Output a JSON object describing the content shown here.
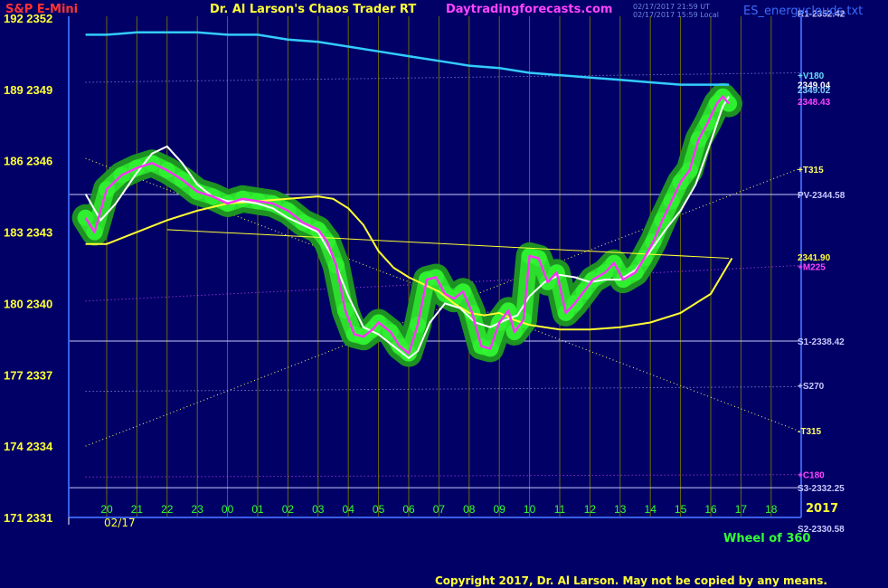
{
  "header": {
    "symbol": "S&P E-Mini",
    "title": "Dr. Al Larson's Chaos Trader RT",
    "site": "Daytradingforecasts.com",
    "stamp1": "02/17/2017 21:59 UT",
    "stamp2": "02/17/2017 15:59 Local",
    "instrument": "ES_energyclouds.txt"
  },
  "footer": {
    "copyright": "Copyright 2017, Dr. Al Larson. May not be copied by any means.",
    "wheel": "Wheel of 360",
    "year": "2017",
    "date": "02/17"
  },
  "colors": {
    "background": "#000066",
    "grid": "#6b6b00",
    "axis": "#3a5ee8",
    "price": "#ff33ff",
    "cloud_outer": "#1f9a1f",
    "cloud_inner": "#2fe62f",
    "slow_ma": "#ffff33",
    "fast_ma": "#ffffff",
    "v180": "#33ccff"
  },
  "chart_data": {
    "type": "line",
    "title": "S&P E-Mini",
    "xlabel": "",
    "ylabel": "",
    "ylim": [
      2331,
      2352
    ],
    "xlim": [
      19.3,
      18.6
    ],
    "x_ticks": [
      "20",
      "21",
      "22",
      "23",
      "00",
      "01",
      "02",
      "03",
      "04",
      "05",
      "06",
      "07",
      "08",
      "09",
      "10",
      "11",
      "12",
      "13",
      "14",
      "15",
      "16",
      "17",
      "18"
    ],
    "y_ticks": [
      {
        "left": "171",
        "value": "2331"
      },
      {
        "left": "174",
        "value": "2334"
      },
      {
        "left": "177",
        "value": "2337"
      },
      {
        "left": "180",
        "value": "2340"
      },
      {
        "left": "183",
        "value": "2343"
      },
      {
        "left": "186",
        "value": "2346"
      },
      {
        "left": "189",
        "value": "2349"
      },
      {
        "left": "192",
        "value": "2352"
      }
    ],
    "series": [
      {
        "name": "price",
        "values": [
          [
            19.3,
            2343.6
          ],
          [
            19.6,
            2343.0
          ],
          [
            20.0,
            2344.8
          ],
          [
            20.5,
            2345.4
          ],
          [
            21.0,
            2345.7
          ],
          [
            21.5,
            2345.9
          ],
          [
            22.0,
            2345.6
          ],
          [
            22.5,
            2345.2
          ],
          [
            23.0,
            2344.7
          ],
          [
            23.5,
            2344.5
          ],
          [
            0.0,
            2344.2
          ],
          [
            0.5,
            2344.4
          ],
          [
            1.0,
            2344.3
          ],
          [
            1.5,
            2344.2
          ],
          [
            2.0,
            2343.9
          ],
          [
            2.5,
            2343.4
          ],
          [
            3.0,
            2343.1
          ],
          [
            3.3,
            2342.6
          ],
          [
            3.6,
            2341.6
          ],
          [
            3.9,
            2339.7
          ],
          [
            4.2,
            2338.7
          ],
          [
            4.5,
            2338.6
          ],
          [
            4.8,
            2338.9
          ],
          [
            5.0,
            2339.2
          ],
          [
            5.4,
            2338.8
          ],
          [
            5.7,
            2338.2
          ],
          [
            6.0,
            2337.9
          ],
          [
            6.3,
            2339.1
          ],
          [
            6.6,
            2341.0
          ],
          [
            6.9,
            2341.1
          ],
          [
            7.2,
            2340.4
          ],
          [
            7.5,
            2340.2
          ],
          [
            7.8,
            2340.5
          ],
          [
            8.1,
            2339.6
          ],
          [
            8.4,
            2338.2
          ],
          [
            8.7,
            2338.1
          ],
          [
            9.0,
            2339.2
          ],
          [
            9.3,
            2339.7
          ],
          [
            9.5,
            2338.8
          ],
          [
            9.8,
            2339.3
          ],
          [
            10.0,
            2342.0
          ],
          [
            10.3,
            2341.9
          ],
          [
            10.6,
            2340.9
          ],
          [
            10.9,
            2341.3
          ],
          [
            11.2,
            2339.6
          ],
          [
            11.5,
            2340.0
          ],
          [
            11.8,
            2340.5
          ],
          [
            12.1,
            2341.0
          ],
          [
            12.5,
            2341.3
          ],
          [
            12.8,
            2341.7
          ],
          [
            13.1,
            2341.0
          ],
          [
            13.5,
            2341.3
          ],
          [
            13.8,
            2341.9
          ],
          [
            14.1,
            2342.6
          ],
          [
            14.4,
            2343.5
          ],
          [
            14.7,
            2344.3
          ],
          [
            15.0,
            2345.1
          ],
          [
            15.3,
            2345.6
          ],
          [
            15.6,
            2346.9
          ],
          [
            15.9,
            2347.6
          ],
          [
            16.2,
            2348.4
          ],
          [
            16.4,
            2348.7
          ],
          [
            16.6,
            2348.4
          ]
        ]
      },
      {
        "name": "fast_ma",
        "values": [
          [
            19.3,
            2344.6
          ],
          [
            19.8,
            2343.5
          ],
          [
            20.3,
            2344.2
          ],
          [
            21.0,
            2345.5
          ],
          [
            21.5,
            2346.3
          ],
          [
            22.0,
            2346.6
          ],
          [
            22.5,
            2345.9
          ],
          [
            23.0,
            2345.0
          ],
          [
            23.5,
            2344.5
          ],
          [
            0.0,
            2344.3
          ],
          [
            0.5,
            2344.3
          ],
          [
            1.0,
            2344.2
          ],
          [
            1.5,
            2344.0
          ],
          [
            2.0,
            2343.6
          ],
          [
            2.5,
            2343.3
          ],
          [
            3.0,
            2343.0
          ],
          [
            3.5,
            2341.9
          ],
          [
            4.0,
            2340.3
          ],
          [
            4.5,
            2339.0
          ],
          [
            5.0,
            2338.7
          ],
          [
            5.5,
            2338.2
          ],
          [
            6.0,
            2337.7
          ],
          [
            6.3,
            2338.0
          ],
          [
            6.7,
            2339.2
          ],
          [
            7.2,
            2340.0
          ],
          [
            7.7,
            2339.8
          ],
          [
            8.2,
            2339.2
          ],
          [
            8.7,
            2339.0
          ],
          [
            9.2,
            2339.3
          ],
          [
            9.6,
            2339.5
          ],
          [
            10.0,
            2340.3
          ],
          [
            10.5,
            2340.9
          ],
          [
            11.0,
            2341.2
          ],
          [
            11.5,
            2341.1
          ],
          [
            12.0,
            2340.9
          ],
          [
            12.5,
            2341.0
          ],
          [
            13.0,
            2341.0
          ],
          [
            13.5,
            2341.4
          ],
          [
            14.0,
            2342.2
          ],
          [
            14.5,
            2343.1
          ],
          [
            15.0,
            2343.9
          ],
          [
            15.5,
            2345.0
          ],
          [
            16.0,
            2346.8
          ],
          [
            16.4,
            2348.3
          ],
          [
            16.6,
            2348.7
          ]
        ]
      },
      {
        "name": "slow_ma",
        "values": [
          [
            19.3,
            2342.5
          ],
          [
            20.0,
            2342.5
          ],
          [
            21.0,
            2343.0
          ],
          [
            22.0,
            2343.5
          ],
          [
            23.0,
            2343.9
          ],
          [
            0.0,
            2344.2
          ],
          [
            1.0,
            2344.3
          ],
          [
            2.0,
            2344.4
          ],
          [
            3.0,
            2344.5
          ],
          [
            3.5,
            2344.4
          ],
          [
            4.0,
            2344.0
          ],
          [
            4.5,
            2343.3
          ],
          [
            5.0,
            2342.2
          ],
          [
            5.5,
            2341.5
          ],
          [
            6.0,
            2341.1
          ],
          [
            6.5,
            2340.8
          ],
          [
            7.0,
            2340.5
          ],
          [
            7.5,
            2340.0
          ],
          [
            8.0,
            2339.6
          ],
          [
            8.5,
            2339.5
          ],
          [
            9.0,
            2339.6
          ],
          [
            9.5,
            2339.3
          ],
          [
            10.0,
            2339.1
          ],
          [
            10.5,
            2339.0
          ],
          [
            11.0,
            2338.9
          ],
          [
            11.5,
            2338.9
          ],
          [
            12.0,
            2338.9
          ],
          [
            13.0,
            2339.0
          ],
          [
            14.0,
            2339.2
          ],
          [
            15.0,
            2339.6
          ],
          [
            16.0,
            2340.4
          ],
          [
            16.7,
            2341.9
          ]
        ]
      },
      {
        "name": "V180",
        "values": [
          [
            19.3,
            2351.3
          ],
          [
            20.0,
            2351.3
          ],
          [
            21.0,
            2351.4
          ],
          [
            22.0,
            2351.4
          ],
          [
            23.0,
            2351.4
          ],
          [
            0.0,
            2351.3
          ],
          [
            1.0,
            2351.3
          ],
          [
            2.0,
            2351.1
          ],
          [
            3.0,
            2351.0
          ],
          [
            4.0,
            2350.8
          ],
          [
            5.0,
            2350.6
          ],
          [
            6.0,
            2350.4
          ],
          [
            7.0,
            2350.2
          ],
          [
            8.0,
            2350.0
          ],
          [
            9.0,
            2349.9
          ],
          [
            10.0,
            2349.7
          ],
          [
            11.0,
            2349.6
          ],
          [
            12.0,
            2349.5
          ],
          [
            13.0,
            2349.4
          ],
          [
            14.0,
            2349.3
          ],
          [
            15.0,
            2349.2
          ],
          [
            16.0,
            2349.2
          ],
          [
            16.6,
            2349.2
          ]
        ]
      },
      {
        "name": "yellow_trend",
        "values": [
          [
            22.0,
            2343.1
          ],
          [
            16.6,
            2341.9
          ]
        ]
      }
    ],
    "hlines": [
      {
        "label": "PV-2344.58",
        "value": 2344.58
      },
      {
        "label": "S1-2338.42",
        "value": 2338.42
      },
      {
        "label": "S3-2332.25",
        "value": 2332.25
      }
    ],
    "dotted_lines": [
      {
        "label": "+V180",
        "from": [
          19.3,
          2349.3
        ],
        "to": [
          18.6,
          2349.7
        ],
        "color": "#9999ff"
      },
      {
        "label": "+T315",
        "from": [
          19.3,
          2334.0
        ],
        "to": [
          18.6,
          2345.7
        ],
        "color": "#ffff66"
      },
      {
        "label": "-T315",
        "from": [
          19.3,
          2346.1
        ],
        "to": [
          18.6,
          2334.6
        ],
        "color": "#ffff66"
      },
      {
        "label": "+M225",
        "from": [
          19.3,
          2340.1
        ],
        "to": [
          18.6,
          2341.6
        ],
        "color": "#cc44ff"
      },
      {
        "label": "+S270",
        "from": [
          19.3,
          2336.3
        ],
        "to": [
          18.6,
          2336.5
        ],
        "color": "#aaaaff"
      },
      {
        "label": "+C180",
        "from": [
          19.3,
          2332.7
        ],
        "to": [
          18.6,
          2332.8
        ],
        "color": "#cc44ff"
      }
    ],
    "right_labels": [
      {
        "text": "R1-2352.42",
        "value": 2352.2,
        "color": "#c8c8ff"
      },
      {
        "text": "+V180",
        "value": 2349.6,
        "color": "#66ddff"
      },
      {
        "text": "2349.04",
        "value": 2349.2,
        "color": "#ffffff"
      },
      {
        "text": "2349.02",
        "value": 2349.0,
        "color": "#7fd4ff"
      },
      {
        "text": "2348.43",
        "value": 2348.5,
        "color": "#ff44ff"
      },
      {
        "text": "+T315",
        "value": 2345.65,
        "color": "#ffff66"
      },
      {
        "text": "PV-2344.58",
        "value": 2344.58,
        "color": "#c8c8ff"
      },
      {
        "text": "2341.90",
        "value": 2341.95,
        "color": "#ffff33"
      },
      {
        "text": "+M225",
        "value": 2341.55,
        "color": "#ff44ff"
      },
      {
        "text": "S1-2338.42",
        "value": 2338.42,
        "color": "#c8c8ff"
      },
      {
        "text": "+S270",
        "value": 2336.55,
        "color": "#c8c8ff"
      },
      {
        "text": "-T315",
        "value": 2334.65,
        "color": "#ffff66"
      },
      {
        "text": "+C180",
        "value": 2332.8,
        "color": "#ff44ff"
      },
      {
        "text": "S3-2332.25",
        "value": 2332.25,
        "color": "#c8c8ff"
      },
      {
        "text": "S2-2330.58",
        "value": 2330.55,
        "color": "#c8c8ff"
      }
    ],
    "grid": true
  }
}
